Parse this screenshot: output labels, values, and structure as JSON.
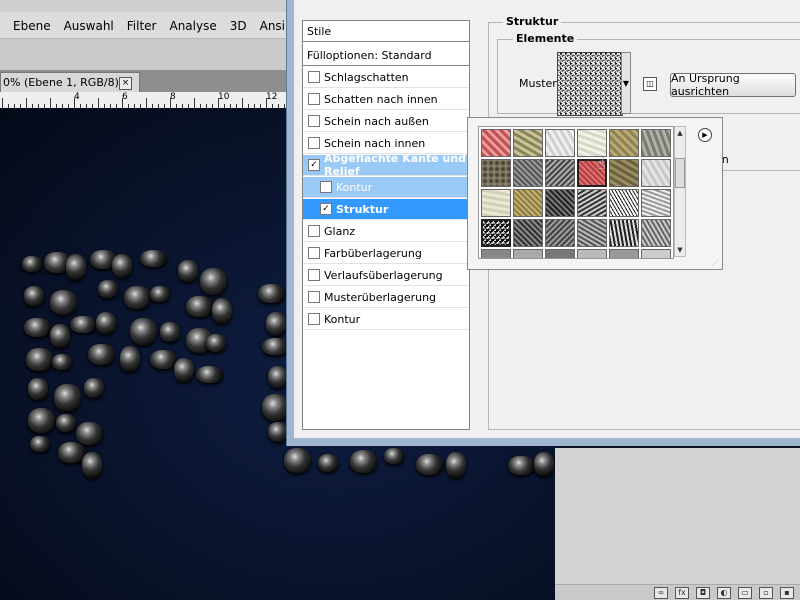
{
  "photoshop": {
    "menu": [
      "Ebene",
      "Auswahl",
      "Filter",
      "Analyse",
      "3D",
      "Ansi"
    ],
    "document_tab": "0% (Ebene 1, RGB/8) *",
    "close_glyph": "×",
    "ruler_labels": [
      "4",
      "6",
      "8",
      "10",
      "12"
    ]
  },
  "styles_panel": {
    "header": "Stile",
    "fill_options": "Fülloptionen: Standard",
    "items": [
      {
        "label": "Schlagschatten",
        "checked": false
      },
      {
        "label": "Schatten nach innen",
        "checked": false
      },
      {
        "label": "Schein nach außen",
        "checked": false
      },
      {
        "label": "Schein nach innen",
        "checked": false
      },
      {
        "label": "Abgeflachte Kante und Relief",
        "checked": true
      },
      {
        "label": "Kontur",
        "checked": false
      },
      {
        "label": "Struktur",
        "checked": true
      },
      {
        "label": "Glanz",
        "checked": false
      },
      {
        "label": "Farbüberlagerung",
        "checked": false
      },
      {
        "label": "Verlaufsüberlagerung",
        "checked": false
      },
      {
        "label": "Musterüberlagerung",
        "checked": false
      },
      {
        "label": "Kontur",
        "checked": false
      }
    ],
    "check_glyph": "✓"
  },
  "struktur": {
    "title": "Struktur",
    "elements_title": "Elemente",
    "pattern_label": "Muster:",
    "snap_button": "An Ursprung ausrichten",
    "hidden_fragment": "den"
  },
  "colors": {
    "selection": "#3399ff",
    "canvas": "#0a1530",
    "dialog_bg": "#f0f0f0"
  },
  "icons": {
    "dropdown": "chevron-down-icon",
    "new_preset": "new-preset-icon",
    "picker_menu": "menu-arrow-icon",
    "link": "link-icon",
    "fx": "fx-icon"
  }
}
